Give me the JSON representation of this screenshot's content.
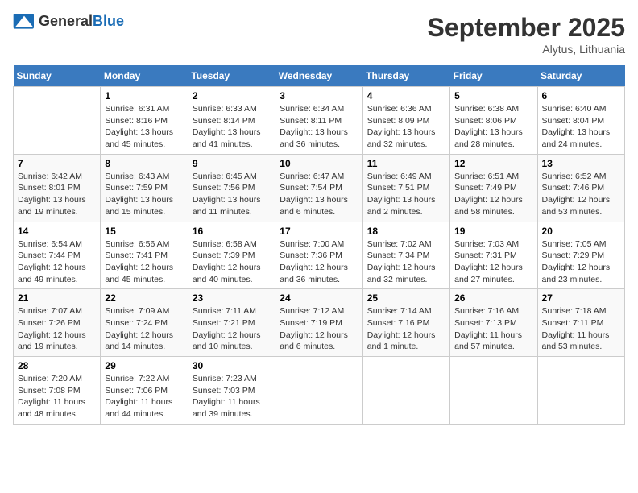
{
  "header": {
    "logo_general": "General",
    "logo_blue": "Blue",
    "month": "September 2025",
    "location": "Alytus, Lithuania"
  },
  "days_of_week": [
    "Sunday",
    "Monday",
    "Tuesday",
    "Wednesday",
    "Thursday",
    "Friday",
    "Saturday"
  ],
  "weeks": [
    [
      null,
      {
        "day": "1",
        "sunrise": "Sunrise: 6:31 AM",
        "sunset": "Sunset: 8:16 PM",
        "daylight": "Daylight: 13 hours and 45 minutes."
      },
      {
        "day": "2",
        "sunrise": "Sunrise: 6:33 AM",
        "sunset": "Sunset: 8:14 PM",
        "daylight": "Daylight: 13 hours and 41 minutes."
      },
      {
        "day": "3",
        "sunrise": "Sunrise: 6:34 AM",
        "sunset": "Sunset: 8:11 PM",
        "daylight": "Daylight: 13 hours and 36 minutes."
      },
      {
        "day": "4",
        "sunrise": "Sunrise: 6:36 AM",
        "sunset": "Sunset: 8:09 PM",
        "daylight": "Daylight: 13 hours and 32 minutes."
      },
      {
        "day": "5",
        "sunrise": "Sunrise: 6:38 AM",
        "sunset": "Sunset: 8:06 PM",
        "daylight": "Daylight: 13 hours and 28 minutes."
      },
      {
        "day": "6",
        "sunrise": "Sunrise: 6:40 AM",
        "sunset": "Sunset: 8:04 PM",
        "daylight": "Daylight: 13 hours and 24 minutes."
      }
    ],
    [
      {
        "day": "7",
        "sunrise": "Sunrise: 6:42 AM",
        "sunset": "Sunset: 8:01 PM",
        "daylight": "Daylight: 13 hours and 19 minutes."
      },
      {
        "day": "8",
        "sunrise": "Sunrise: 6:43 AM",
        "sunset": "Sunset: 7:59 PM",
        "daylight": "Daylight: 13 hours and 15 minutes."
      },
      {
        "day": "9",
        "sunrise": "Sunrise: 6:45 AM",
        "sunset": "Sunset: 7:56 PM",
        "daylight": "Daylight: 13 hours and 11 minutes."
      },
      {
        "day": "10",
        "sunrise": "Sunrise: 6:47 AM",
        "sunset": "Sunset: 7:54 PM",
        "daylight": "Daylight: 13 hours and 6 minutes."
      },
      {
        "day": "11",
        "sunrise": "Sunrise: 6:49 AM",
        "sunset": "Sunset: 7:51 PM",
        "daylight": "Daylight: 13 hours and 2 minutes."
      },
      {
        "day": "12",
        "sunrise": "Sunrise: 6:51 AM",
        "sunset": "Sunset: 7:49 PM",
        "daylight": "Daylight: 12 hours and 58 minutes."
      },
      {
        "day": "13",
        "sunrise": "Sunrise: 6:52 AM",
        "sunset": "Sunset: 7:46 PM",
        "daylight": "Daylight: 12 hours and 53 minutes."
      }
    ],
    [
      {
        "day": "14",
        "sunrise": "Sunrise: 6:54 AM",
        "sunset": "Sunset: 7:44 PM",
        "daylight": "Daylight: 12 hours and 49 minutes."
      },
      {
        "day": "15",
        "sunrise": "Sunrise: 6:56 AM",
        "sunset": "Sunset: 7:41 PM",
        "daylight": "Daylight: 12 hours and 45 minutes."
      },
      {
        "day": "16",
        "sunrise": "Sunrise: 6:58 AM",
        "sunset": "Sunset: 7:39 PM",
        "daylight": "Daylight: 12 hours and 40 minutes."
      },
      {
        "day": "17",
        "sunrise": "Sunrise: 7:00 AM",
        "sunset": "Sunset: 7:36 PM",
        "daylight": "Daylight: 12 hours and 36 minutes."
      },
      {
        "day": "18",
        "sunrise": "Sunrise: 7:02 AM",
        "sunset": "Sunset: 7:34 PM",
        "daylight": "Daylight: 12 hours and 32 minutes."
      },
      {
        "day": "19",
        "sunrise": "Sunrise: 7:03 AM",
        "sunset": "Sunset: 7:31 PM",
        "daylight": "Daylight: 12 hours and 27 minutes."
      },
      {
        "day": "20",
        "sunrise": "Sunrise: 7:05 AM",
        "sunset": "Sunset: 7:29 PM",
        "daylight": "Daylight: 12 hours and 23 minutes."
      }
    ],
    [
      {
        "day": "21",
        "sunrise": "Sunrise: 7:07 AM",
        "sunset": "Sunset: 7:26 PM",
        "daylight": "Daylight: 12 hours and 19 minutes."
      },
      {
        "day": "22",
        "sunrise": "Sunrise: 7:09 AM",
        "sunset": "Sunset: 7:24 PM",
        "daylight": "Daylight: 12 hours and 14 minutes."
      },
      {
        "day": "23",
        "sunrise": "Sunrise: 7:11 AM",
        "sunset": "Sunset: 7:21 PM",
        "daylight": "Daylight: 12 hours and 10 minutes."
      },
      {
        "day": "24",
        "sunrise": "Sunrise: 7:12 AM",
        "sunset": "Sunset: 7:19 PM",
        "daylight": "Daylight: 12 hours and 6 minutes."
      },
      {
        "day": "25",
        "sunrise": "Sunrise: 7:14 AM",
        "sunset": "Sunset: 7:16 PM",
        "daylight": "Daylight: 12 hours and 1 minute."
      },
      {
        "day": "26",
        "sunrise": "Sunrise: 7:16 AM",
        "sunset": "Sunset: 7:13 PM",
        "daylight": "Daylight: 11 hours and 57 minutes."
      },
      {
        "day": "27",
        "sunrise": "Sunrise: 7:18 AM",
        "sunset": "Sunset: 7:11 PM",
        "daylight": "Daylight: 11 hours and 53 minutes."
      }
    ],
    [
      {
        "day": "28",
        "sunrise": "Sunrise: 7:20 AM",
        "sunset": "Sunset: 7:08 PM",
        "daylight": "Daylight: 11 hours and 48 minutes."
      },
      {
        "day": "29",
        "sunrise": "Sunrise: 7:22 AM",
        "sunset": "Sunset: 7:06 PM",
        "daylight": "Daylight: 11 hours and 44 minutes."
      },
      {
        "day": "30",
        "sunrise": "Sunrise: 7:23 AM",
        "sunset": "Sunset: 7:03 PM",
        "daylight": "Daylight: 11 hours and 39 minutes."
      },
      null,
      null,
      null,
      null
    ]
  ]
}
